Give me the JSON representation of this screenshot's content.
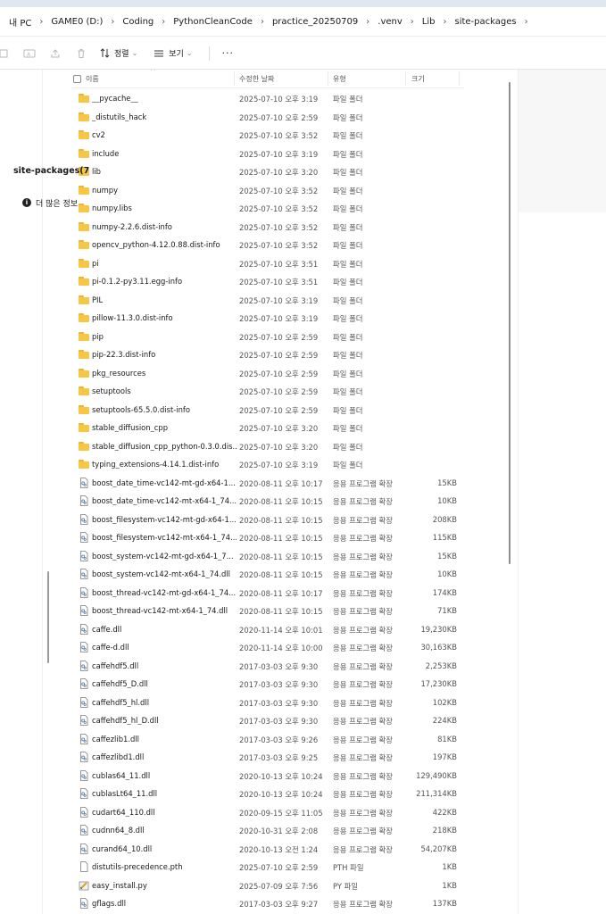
{
  "breadcrumb": [
    "내 PC",
    "GAME0 (D:)",
    "Coding",
    "PythonCleanCode",
    "practice_20250709",
    ".venv",
    "Lib",
    "site-packages"
  ],
  "toolbar": {
    "sort_label": "정렬",
    "view_label": "보기",
    "more_label": "···"
  },
  "columns": {
    "name": "이름",
    "date": "수정한 날짜",
    "type": "유형",
    "size": "크기"
  },
  "files": [
    {
      "kind": "folder",
      "name": "__pycache__",
      "date": "2025-07-10 오후 3:19",
      "type": "파일 폴더",
      "size": ""
    },
    {
      "kind": "folder",
      "name": "_distutils_hack",
      "date": "2025-07-10 오후 2:59",
      "type": "파일 폴더",
      "size": ""
    },
    {
      "kind": "folder",
      "name": "cv2",
      "date": "2025-07-10 오후 3:52",
      "type": "파일 폴더",
      "size": ""
    },
    {
      "kind": "folder",
      "name": "include",
      "date": "2025-07-10 오후 3:19",
      "type": "파일 폴더",
      "size": ""
    },
    {
      "kind": "folder",
      "name": "lib",
      "date": "2025-07-10 오후 3:20",
      "type": "파일 폴더",
      "size": ""
    },
    {
      "kind": "folder",
      "name": "numpy",
      "date": "2025-07-10 오후 3:52",
      "type": "파일 폴더",
      "size": ""
    },
    {
      "kind": "folder",
      "name": "numpy.libs",
      "date": "2025-07-10 오후 3:52",
      "type": "파일 폴더",
      "size": ""
    },
    {
      "kind": "folder",
      "name": "numpy-2.2.6.dist-info",
      "date": "2025-07-10 오후 3:52",
      "type": "파일 폴더",
      "size": ""
    },
    {
      "kind": "folder",
      "name": "opencv_python-4.12.0.88.dist-info",
      "date": "2025-07-10 오후 3:52",
      "type": "파일 폴더",
      "size": ""
    },
    {
      "kind": "folder",
      "name": "pi",
      "date": "2025-07-10 오후 3:51",
      "type": "파일 폴더",
      "size": ""
    },
    {
      "kind": "folder",
      "name": "pi-0.1.2-py3.11.egg-info",
      "date": "2025-07-10 오후 3:51",
      "type": "파일 폴더",
      "size": ""
    },
    {
      "kind": "folder",
      "name": "PIL",
      "date": "2025-07-10 오후 3:19",
      "type": "파일 폴더",
      "size": ""
    },
    {
      "kind": "folder",
      "name": "pillow-11.3.0.dist-info",
      "date": "2025-07-10 오후 3:19",
      "type": "파일 폴더",
      "size": ""
    },
    {
      "kind": "folder",
      "name": "pip",
      "date": "2025-07-10 오후 2:59",
      "type": "파일 폴더",
      "size": ""
    },
    {
      "kind": "folder",
      "name": "pip-22.3.dist-info",
      "date": "2025-07-10 오후 2:59",
      "type": "파일 폴더",
      "size": ""
    },
    {
      "kind": "folder",
      "name": "pkg_resources",
      "date": "2025-07-10 오후 2:59",
      "type": "파일 폴더",
      "size": ""
    },
    {
      "kind": "folder",
      "name": "setuptools",
      "date": "2025-07-10 오후 2:59",
      "type": "파일 폴더",
      "size": ""
    },
    {
      "kind": "folder",
      "name": "setuptools-65.5.0.dist-info",
      "date": "2025-07-10 오후 2:59",
      "type": "파일 폴더",
      "size": ""
    },
    {
      "kind": "folder",
      "name": "stable_diffusion_cpp",
      "date": "2025-07-10 오후 3:20",
      "type": "파일 폴더",
      "size": ""
    },
    {
      "kind": "folder",
      "name": "stable_diffusion_cpp_python-0.3.0.dis...",
      "date": "2025-07-10 오후 3:20",
      "type": "파일 폴더",
      "size": ""
    },
    {
      "kind": "folder",
      "name": "typing_extensions-4.14.1.dist-info",
      "date": "2025-07-10 오후 3:19",
      "type": "파일 폴더",
      "size": ""
    },
    {
      "kind": "dll",
      "name": "boost_date_time-vc142-mt-gd-x64-1...",
      "date": "2020-08-11 오후 10:17",
      "type": "응용 프로그램 확장",
      "size": "15KB"
    },
    {
      "kind": "dll",
      "name": "boost_date_time-vc142-mt-x64-1_74...",
      "date": "2020-08-11 오후 10:15",
      "type": "응용 프로그램 확장",
      "size": "10KB"
    },
    {
      "kind": "dll",
      "name": "boost_filesystem-vc142-mt-gd-x64-1...",
      "date": "2020-08-11 오후 10:15",
      "type": "응용 프로그램 확장",
      "size": "208KB"
    },
    {
      "kind": "dll",
      "name": "boost_filesystem-vc142-mt-x64-1_74...",
      "date": "2020-08-11 오후 10:15",
      "type": "응용 프로그램 확장",
      "size": "115KB"
    },
    {
      "kind": "dll",
      "name": "boost_system-vc142-mt-gd-x64-1_7...",
      "date": "2020-08-11 오후 10:15",
      "type": "응용 프로그램 확장",
      "size": "15KB"
    },
    {
      "kind": "dll",
      "name": "boost_system-vc142-mt-x64-1_74.dll",
      "date": "2020-08-11 오후 10:15",
      "type": "응용 프로그램 확장",
      "size": "10KB"
    },
    {
      "kind": "dll",
      "name": "boost_thread-vc142-mt-gd-x64-1_74...",
      "date": "2020-08-11 오후 10:17",
      "type": "응용 프로그램 확장",
      "size": "174KB"
    },
    {
      "kind": "dll",
      "name": "boost_thread-vc142-mt-x64-1_74.dll",
      "date": "2020-08-11 오후 10:15",
      "type": "응용 프로그램 확장",
      "size": "71KB"
    },
    {
      "kind": "dll",
      "name": "caffe.dll",
      "date": "2020-11-14 오후 10:01",
      "type": "응용 프로그램 확장",
      "size": "19,230KB"
    },
    {
      "kind": "dll",
      "name": "caffe-d.dll",
      "date": "2020-11-14 오후 10:00",
      "type": "응용 프로그램 확장",
      "size": "30,163KB"
    },
    {
      "kind": "dll",
      "name": "caffehdf5.dll",
      "date": "2017-03-03 오후 9:30",
      "type": "응용 프로그램 확장",
      "size": "2,253KB"
    },
    {
      "kind": "dll",
      "name": "caffehdf5_D.dll",
      "date": "2017-03-03 오후 9:30",
      "type": "응용 프로그램 확장",
      "size": "17,230KB"
    },
    {
      "kind": "dll",
      "name": "caffehdf5_hl.dll",
      "date": "2017-03-03 오후 9:30",
      "type": "응용 프로그램 확장",
      "size": "102KB"
    },
    {
      "kind": "dll",
      "name": "caffehdf5_hl_D.dll",
      "date": "2017-03-03 오후 9:30",
      "type": "응용 프로그램 확장",
      "size": "224KB"
    },
    {
      "kind": "dll",
      "name": "caffezlib1.dll",
      "date": "2017-03-03 오후 9:26",
      "type": "응용 프로그램 확장",
      "size": "81KB"
    },
    {
      "kind": "dll",
      "name": "caffezlibd1.dll",
      "date": "2017-03-03 오후 9:25",
      "type": "응용 프로그램 확장",
      "size": "197KB"
    },
    {
      "kind": "dll",
      "name": "cublas64_11.dll",
      "date": "2020-10-13 오후 10:24",
      "type": "응용 프로그램 확장",
      "size": "129,490KB"
    },
    {
      "kind": "dll",
      "name": "cublasLt64_11.dll",
      "date": "2020-10-13 오후 10:24",
      "type": "응용 프로그램 확장",
      "size": "211,314KB"
    },
    {
      "kind": "dll",
      "name": "cudart64_110.dll",
      "date": "2020-09-15 오후 11:05",
      "type": "응용 프로그램 확장",
      "size": "422KB"
    },
    {
      "kind": "dll",
      "name": "cudnn64_8.dll",
      "date": "2020-10-31 오후 2:08",
      "type": "응용 프로그램 확장",
      "size": "218KB"
    },
    {
      "kind": "dll",
      "name": "curand64_10.dll",
      "date": "2020-10-13 오전 1:24",
      "type": "응용 프로그램 확장",
      "size": "54,207KB"
    },
    {
      "kind": "file",
      "name": "distutils-precedence.pth",
      "date": "2025-07-10 오후 2:59",
      "type": "PTH 파일",
      "size": "1KB"
    },
    {
      "kind": "py",
      "name": "easy_install.py",
      "date": "2025-07-09 오후 7:56",
      "type": "PY 파일",
      "size": "1KB"
    },
    {
      "kind": "dll",
      "name": "gflags.dll",
      "date": "2017-03-03 오후 9:27",
      "type": "응용 프로그램 확장",
      "size": "137KB"
    }
  ],
  "details": {
    "title": "site-packages(7",
    "info": "더 많은 정보"
  }
}
